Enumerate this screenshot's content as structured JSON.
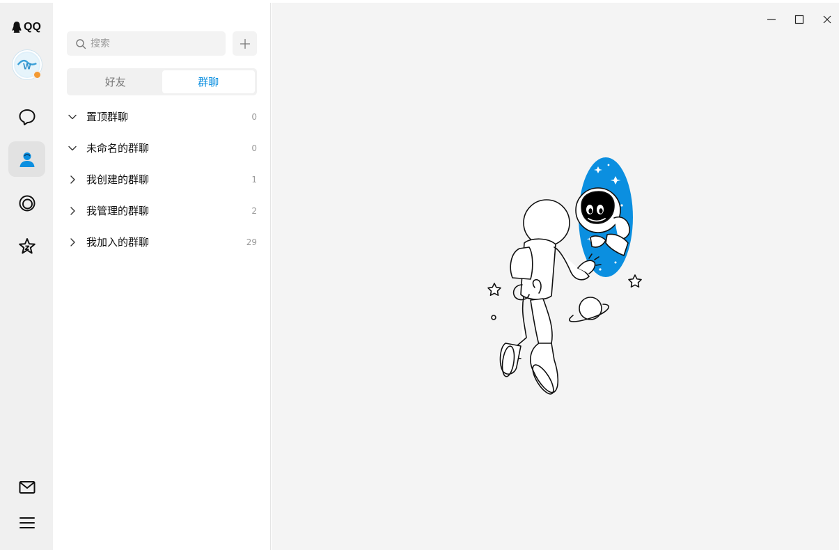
{
  "app": {
    "logo_text": "QQ"
  },
  "sidebar": {
    "items": [
      {
        "name": "messages",
        "icon": "chat-bubble-icon"
      },
      {
        "name": "contacts",
        "icon": "contacts-person-icon",
        "active": true
      },
      {
        "name": "channels",
        "icon": "channel-ring-icon"
      },
      {
        "name": "favorites",
        "icon": "star-icon"
      }
    ],
    "bottom": [
      {
        "name": "mail",
        "icon": "mail-icon"
      },
      {
        "name": "menu",
        "icon": "hamburger-menu-icon"
      }
    ]
  },
  "search": {
    "placeholder": "搜索"
  },
  "tabs": [
    {
      "label": "好友",
      "active": false
    },
    {
      "label": "群聊",
      "active": true
    }
  ],
  "groups": [
    {
      "name": "置顶群聊",
      "count": "0",
      "expanded": true
    },
    {
      "name": "未命名的群聊",
      "count": "0",
      "expanded": true
    },
    {
      "name": "我创建的群聊",
      "count": "1",
      "expanded": false
    },
    {
      "name": "我管理的群聊",
      "count": "2",
      "expanded": false
    },
    {
      "name": "我加入的群聊",
      "count": "29",
      "expanded": false
    }
  ],
  "colors": {
    "accent": "#0b8fe0",
    "nav_bg": "#f0f0f0",
    "main_bg": "#f4f4f4",
    "portal": "#0b8fe0"
  }
}
